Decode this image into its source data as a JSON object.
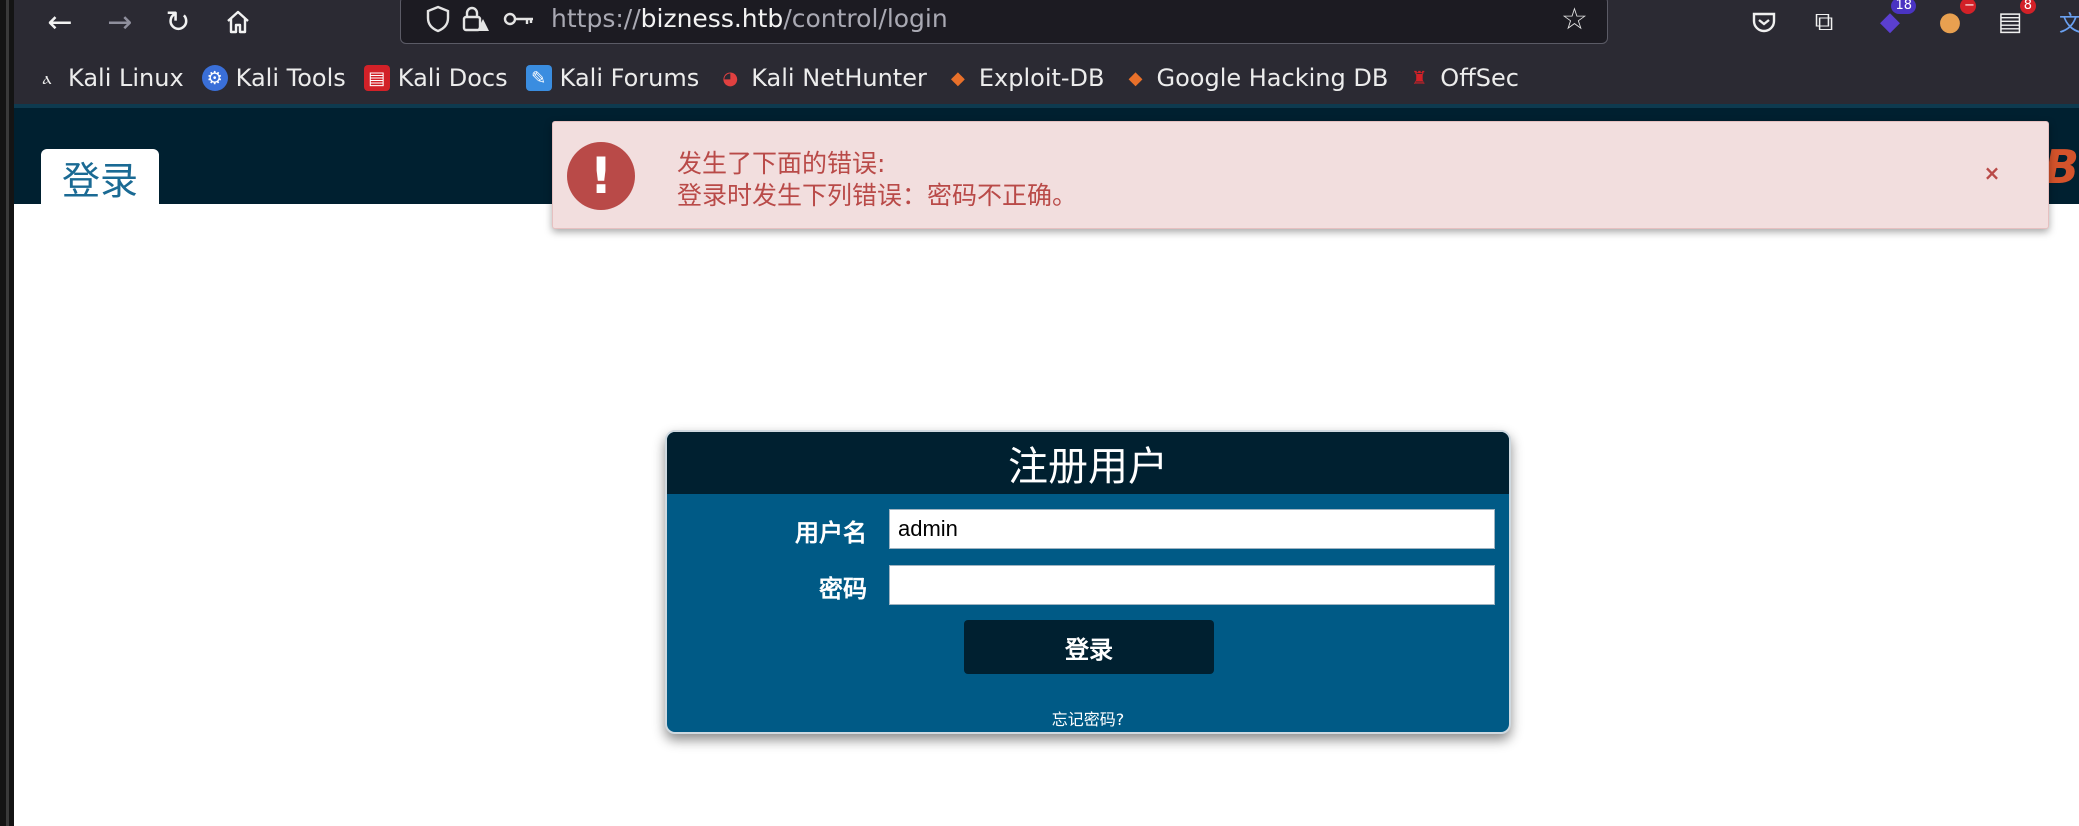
{
  "browser": {
    "url_scheme": "https://",
    "url_host": "bizness.htb",
    "url_path": "/control/login",
    "extension_badges": {
      "ext1": "18",
      "ext3": "8"
    }
  },
  "bookmarks": [
    {
      "label": "Kali Linux",
      "icon": "kali-dragon-icon",
      "color": "#2b2a33"
    },
    {
      "label": "Kali Tools",
      "icon": "kali-tools-icon",
      "color": "#3a6fd8"
    },
    {
      "label": "Kali Docs",
      "icon": "kali-docs-icon",
      "color": "#d22128"
    },
    {
      "label": "Kali Forums",
      "icon": "kali-forums-icon",
      "color": "#3a8de0"
    },
    {
      "label": "Kali NetHunter",
      "icon": "nethunter-icon",
      "color": "#e04040"
    },
    {
      "label": "Exploit-DB",
      "icon": "exploit-db-icon",
      "color": "#e8702a"
    },
    {
      "label": "Google Hacking DB",
      "icon": "ghdb-icon",
      "color": "#e8702a"
    },
    {
      "label": "OffSec",
      "icon": "offsec-icon",
      "color": "#d22128"
    }
  ],
  "page": {
    "tab_label": "登录",
    "brand_peek": "Bi"
  },
  "alert": {
    "title": "发生了下面的错误:",
    "message": "登录时发生下列错误：密码不正确。",
    "close": "×"
  },
  "login": {
    "heading": "注册用户",
    "username_label": "用户名",
    "username_value": "admin",
    "password_label": "密码",
    "password_value": "",
    "submit_label": "登录",
    "forgot_link": "忘记密码?"
  },
  "colors": {
    "header_bg": "#002030",
    "form_bg": "#005a86",
    "alert_bg": "#f2dede",
    "alert_text": "#b94a48"
  }
}
